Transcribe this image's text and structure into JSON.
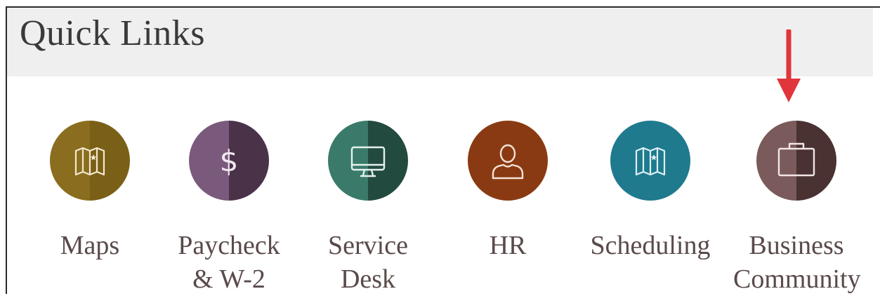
{
  "page": {
    "title": "Quick Links"
  },
  "links": [
    {
      "label_line1": "Maps",
      "label_line2": "",
      "icon": "map-icon",
      "color_left": "#8a6d1e",
      "color_right": "#7a5f17"
    },
    {
      "label_line1": "Paycheck",
      "label_line2": "& W-2",
      "icon": "dollar-icon",
      "color_left": "#7a5a7c",
      "color_right": "#4a3348"
    },
    {
      "label_line1": "Service",
      "label_line2": "Desk",
      "icon": "monitor-icon",
      "color_left": "#3a7a6a",
      "color_right": "#234a3e"
    },
    {
      "label_line1": "HR",
      "label_line2": "",
      "icon": "person-icon",
      "color_left": "#8a3a12",
      "color_right": "#8a3a12"
    },
    {
      "label_line1": "Scheduling",
      "label_line2": "",
      "icon": "map-icon",
      "color_left": "#1f7a8e",
      "color_right": "#1f7a8e"
    },
    {
      "label_line1": "Business",
      "label_line2": "Community",
      "icon": "briefcase-icon",
      "color_left": "#7a5a5a",
      "color_right": "#4a3232"
    }
  ],
  "annotation": {
    "arrow_color": "#e0353b"
  }
}
